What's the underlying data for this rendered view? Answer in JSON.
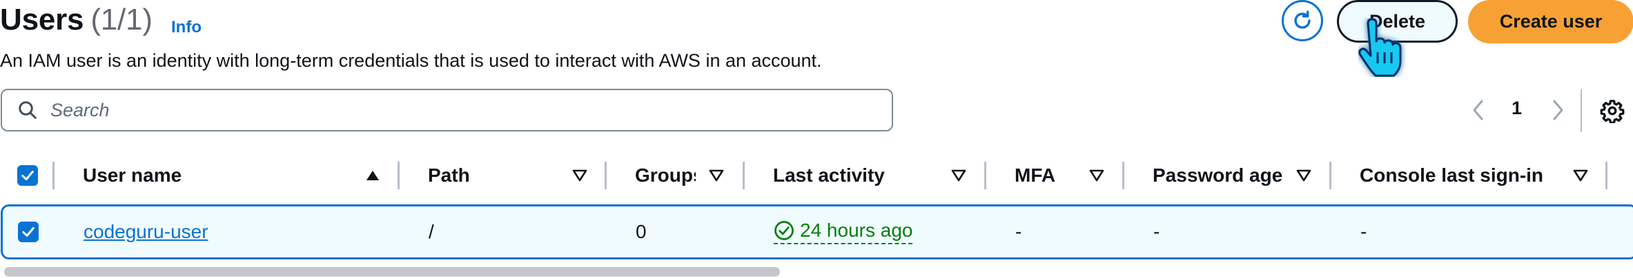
{
  "header": {
    "title": "Users",
    "count": "(1/1)",
    "info_label": "Info",
    "description": "An IAM user is an identity with long-term credentials that is used to interact with AWS in an account."
  },
  "actions": {
    "refresh_icon": "refresh-icon",
    "delete_label": "Delete",
    "create_label": "Create user"
  },
  "search": {
    "placeholder": "Search"
  },
  "pagination": {
    "current_page": "1"
  },
  "table": {
    "columns": [
      {
        "label": "User name",
        "sort": "ascending"
      },
      {
        "label": "Path",
        "sort": "none"
      },
      {
        "label": "Groups",
        "sort": "none"
      },
      {
        "label": "Last activity",
        "sort": "none"
      },
      {
        "label": "MFA",
        "sort": "none"
      },
      {
        "label": "Password age",
        "sort": "none"
      },
      {
        "label": "Console last sign-in",
        "sort": "none"
      }
    ],
    "rows": [
      {
        "selected": true,
        "user_name": "codeguru-user",
        "path": "/",
        "groups": "0",
        "last_activity": "24 hours ago",
        "mfa": "-",
        "password_age": "-",
        "console_last_sign_in": "-"
      }
    ]
  },
  "colors": {
    "accent": "#0972d3",
    "primary_button": "#f7a134",
    "success": "#037f0c"
  }
}
